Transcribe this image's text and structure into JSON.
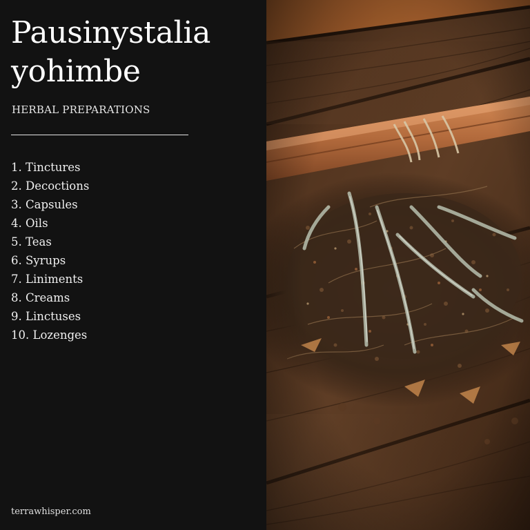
{
  "title_line1": "Pausinystalia",
  "title_line2": "yohimbe",
  "subtitle": "HERBAL PREPARATIONS",
  "preparations": [
    "1. Tinctures",
    "2. Decoctions",
    "3. Capsules",
    "4. Oils",
    "5. Teas",
    "6. Syrups",
    "7. Liniments",
    "8. Creams",
    "9. Linctuses",
    "10. Lozenges"
  ],
  "footer": "terrawhisper.com",
  "colors": {
    "panel_background": "#121212",
    "text": "#ffffff",
    "wood_dark": "#2b1a0f",
    "wood_mid": "#5a3a22",
    "cinnamon": "#b5683a",
    "herb_green": "#8c9a7e"
  }
}
